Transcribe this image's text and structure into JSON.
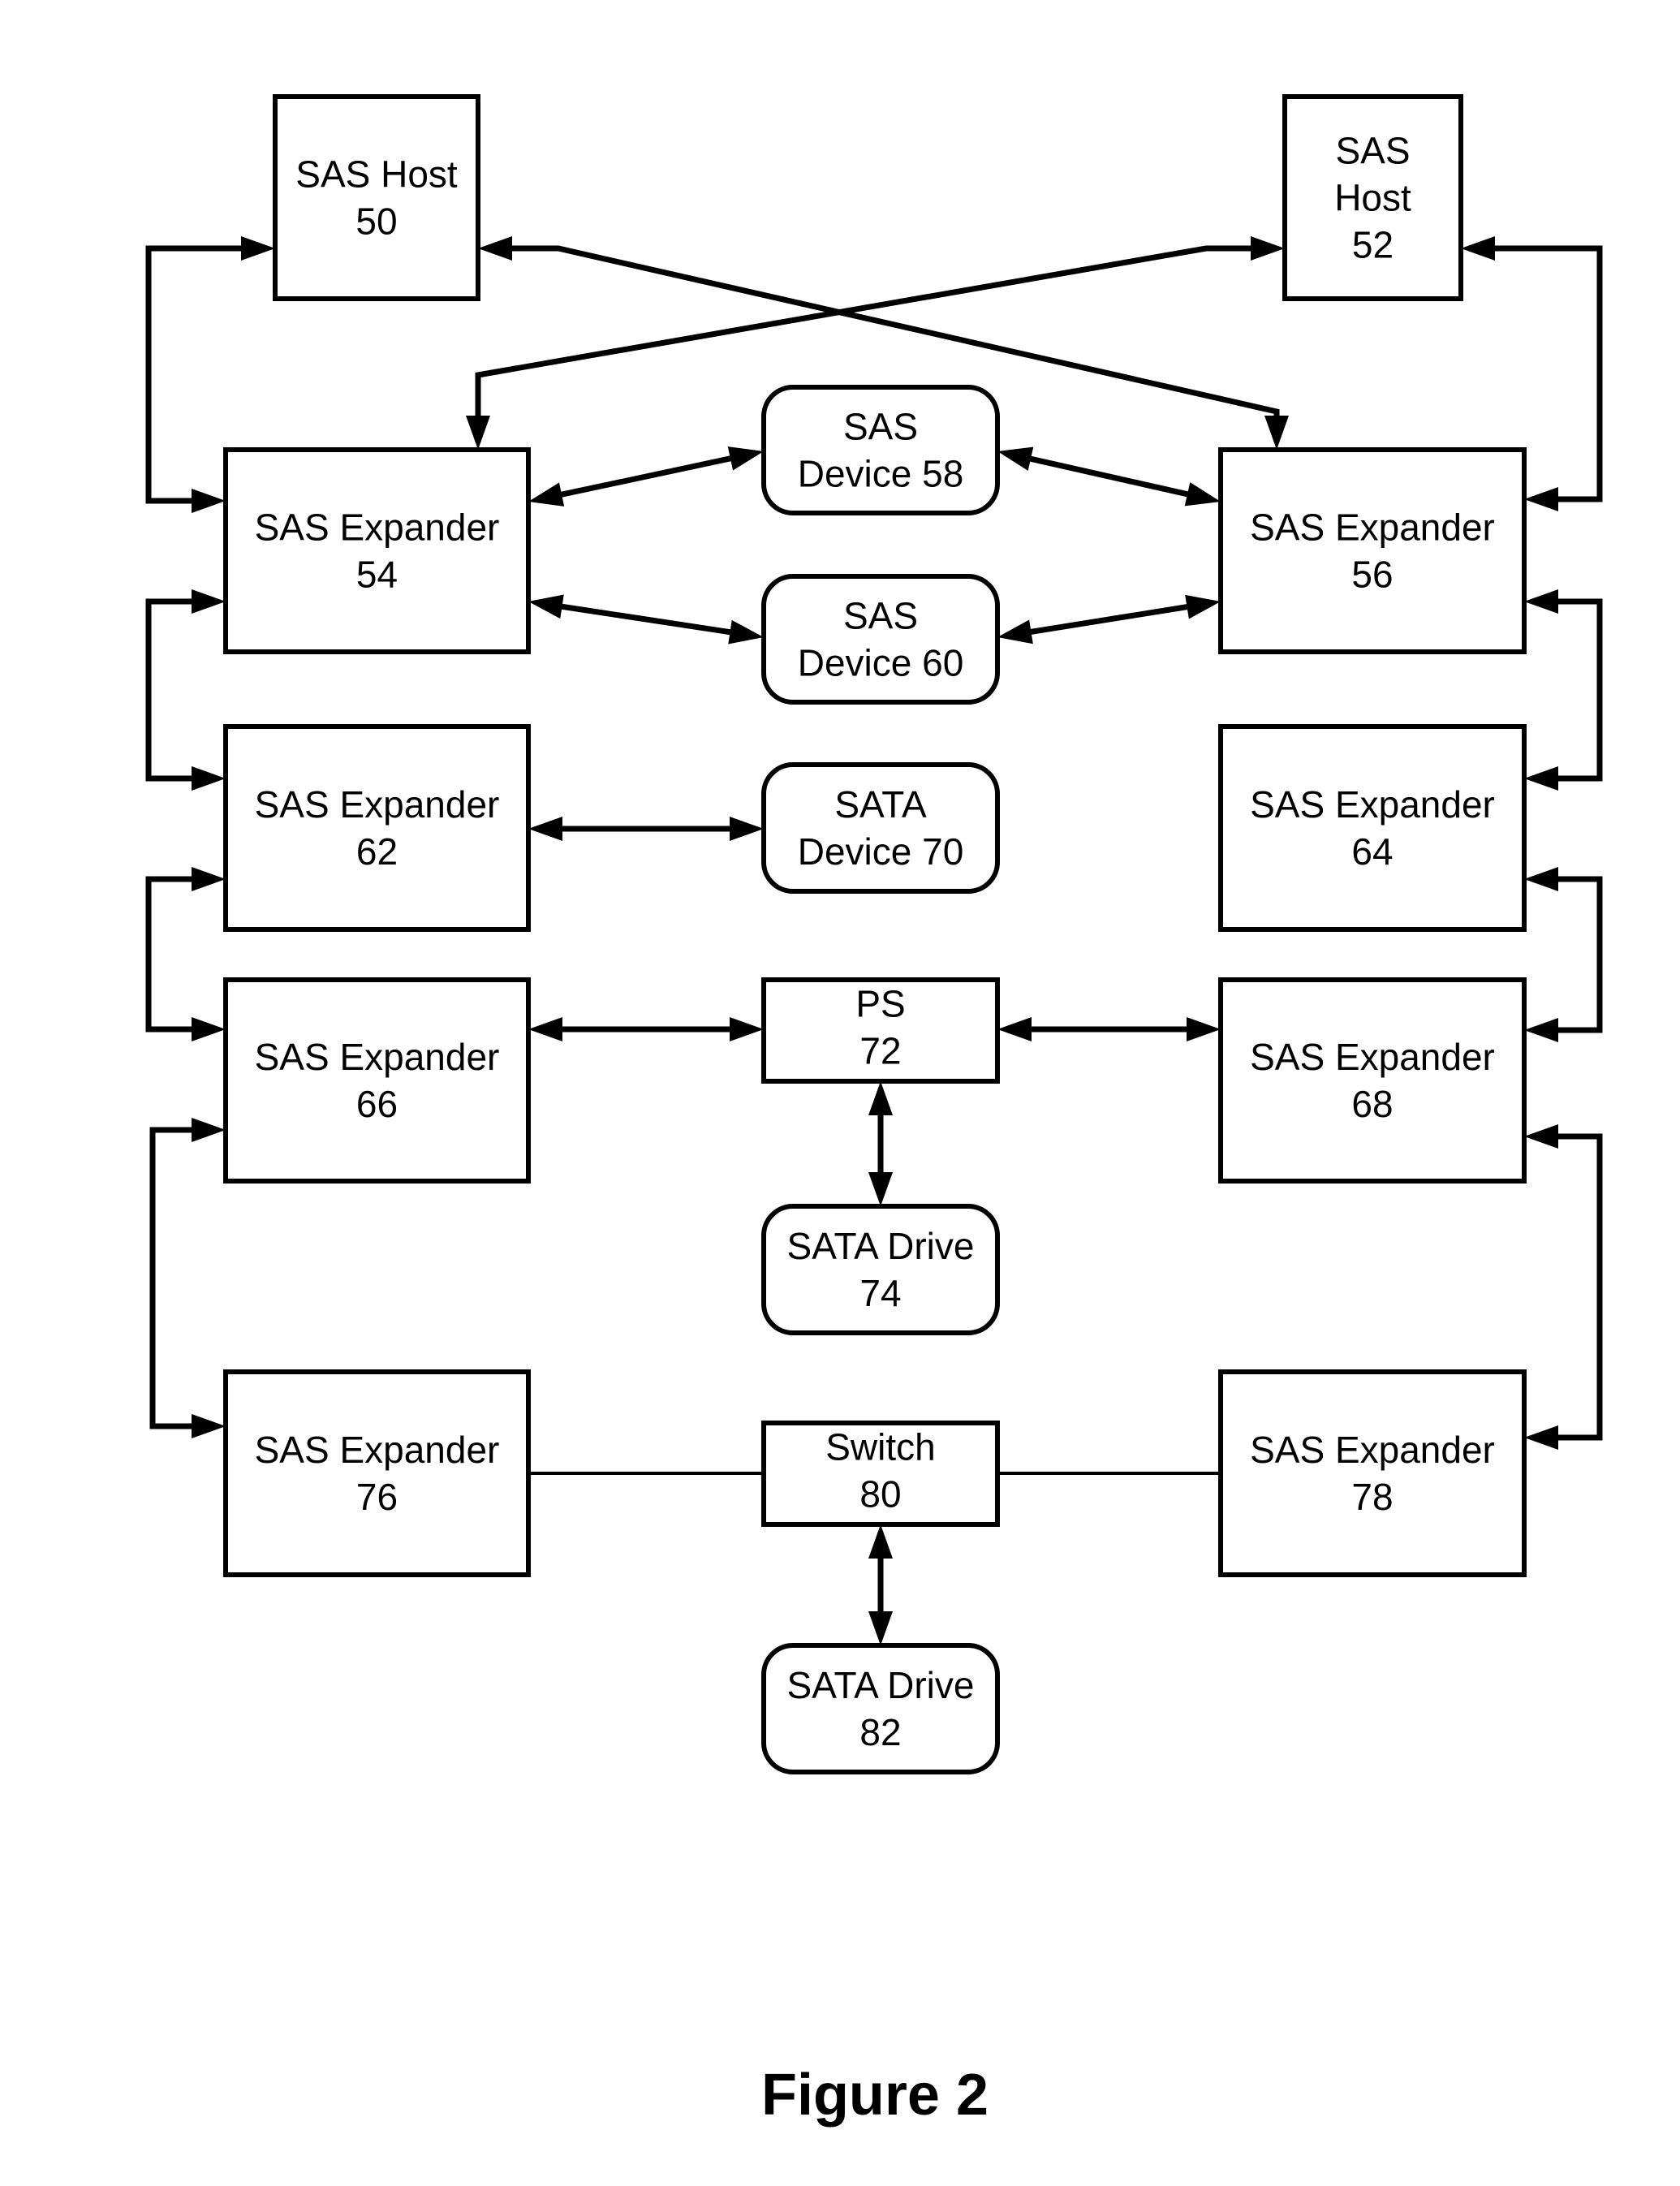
{
  "figure": {
    "caption": "Figure 2",
    "colors": {
      "line": "#000000",
      "background": "#ffffff"
    }
  },
  "nodes": [
    {
      "id": "sas-host-50",
      "shape": "rect",
      "lines": [
        "SAS Host",
        "50"
      ]
    },
    {
      "id": "sas-host-52",
      "shape": "rect",
      "lines": [
        "SAS",
        "Host",
        "52"
      ]
    },
    {
      "id": "sas-expander-54",
      "shape": "rect",
      "lines": [
        "SAS Expander",
        "54"
      ]
    },
    {
      "id": "sas-expander-56",
      "shape": "rect",
      "lines": [
        "SAS Expander",
        "56"
      ]
    },
    {
      "id": "sas-device-58",
      "shape": "rounded",
      "lines": [
        "SAS",
        "Device 58"
      ]
    },
    {
      "id": "sas-device-60",
      "shape": "rounded",
      "lines": [
        "SAS",
        "Device 60"
      ]
    },
    {
      "id": "sas-expander-62",
      "shape": "rect",
      "lines": [
        "SAS Expander",
        "62"
      ]
    },
    {
      "id": "sas-expander-64",
      "shape": "rect",
      "lines": [
        "SAS Expander",
        "64"
      ]
    },
    {
      "id": "sata-device-70",
      "shape": "rounded",
      "lines": [
        "SATA",
        "Device 70"
      ]
    },
    {
      "id": "sas-expander-66",
      "shape": "rect",
      "lines": [
        "SAS Expander",
        "66"
      ]
    },
    {
      "id": "sas-expander-68",
      "shape": "rect",
      "lines": [
        "SAS Expander",
        "68"
      ]
    },
    {
      "id": "ps-72",
      "shape": "rect",
      "lines": [
        "PS",
        "72"
      ]
    },
    {
      "id": "sata-drive-74",
      "shape": "rounded",
      "lines": [
        "SATA Drive",
        "74"
      ]
    },
    {
      "id": "sas-expander-76",
      "shape": "rect",
      "lines": [
        "SAS Expander",
        "76"
      ]
    },
    {
      "id": "sas-expander-78",
      "shape": "rect",
      "lines": [
        "SAS Expander",
        "78"
      ]
    },
    {
      "id": "switch-80",
      "shape": "rect",
      "lines": [
        "Switch",
        "80"
      ]
    },
    {
      "id": "sata-drive-82",
      "shape": "rounded",
      "lines": [
        "SATA Drive",
        "82"
      ]
    }
  ],
  "connections": [
    {
      "id": "host50-exp54",
      "from": "sas-host-50",
      "to": "sas-expander-54",
      "type": "bidirectional"
    },
    {
      "id": "host50-exp56",
      "from": "sas-host-50",
      "to": "sas-expander-56",
      "type": "bidirectional"
    },
    {
      "id": "host52-exp54",
      "from": "sas-host-52",
      "to": "sas-expander-54",
      "type": "bidirectional"
    },
    {
      "id": "host52-exp56",
      "from": "sas-host-52",
      "to": "sas-expander-56",
      "type": "bidirectional"
    },
    {
      "id": "exp54-dev58",
      "from": "sas-expander-54",
      "to": "sas-device-58",
      "type": "bidirectional"
    },
    {
      "id": "dev58-exp56",
      "from": "sas-device-58",
      "to": "sas-expander-56",
      "type": "bidirectional"
    },
    {
      "id": "exp54-dev60",
      "from": "sas-expander-54",
      "to": "sas-device-60",
      "type": "bidirectional"
    },
    {
      "id": "dev60-exp56",
      "from": "sas-device-60",
      "to": "sas-expander-56",
      "type": "bidirectional"
    },
    {
      "id": "exp54-exp62",
      "from": "sas-expander-54",
      "to": "sas-expander-62",
      "type": "bidirectional"
    },
    {
      "id": "exp56-exp64",
      "from": "sas-expander-56",
      "to": "sas-expander-64",
      "type": "bidirectional"
    },
    {
      "id": "exp62-sata70",
      "from": "sas-expander-62",
      "to": "sata-device-70",
      "type": "bidirectional"
    },
    {
      "id": "exp62-exp66",
      "from": "sas-expander-62",
      "to": "sas-expander-66",
      "type": "bidirectional"
    },
    {
      "id": "exp64-exp68",
      "from": "sas-expander-64",
      "to": "sas-expander-68",
      "type": "bidirectional"
    },
    {
      "id": "exp66-ps72",
      "from": "sas-expander-66",
      "to": "ps-72",
      "type": "bidirectional"
    },
    {
      "id": "ps72-exp68",
      "from": "ps-72",
      "to": "sas-expander-68",
      "type": "bidirectional"
    },
    {
      "id": "ps72-drive74",
      "from": "ps-72",
      "to": "sata-drive-74",
      "type": "bidirectional"
    },
    {
      "id": "exp66-exp76",
      "from": "sas-expander-66",
      "to": "sas-expander-76",
      "type": "bidirectional"
    },
    {
      "id": "exp68-exp78",
      "from": "sas-expander-68",
      "to": "sas-expander-78",
      "type": "bidirectional"
    },
    {
      "id": "exp76-switch80",
      "from": "sas-expander-76",
      "to": "switch-80",
      "type": "line"
    },
    {
      "id": "switch80-exp78",
      "from": "switch-80",
      "to": "sas-expander-78",
      "type": "line"
    },
    {
      "id": "switch80-drive82",
      "from": "switch-80",
      "to": "sata-drive-82",
      "type": "bidirectional"
    }
  ]
}
